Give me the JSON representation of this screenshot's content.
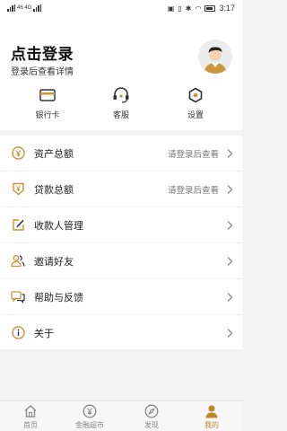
{
  "status_bar": {
    "left_text": "46 4G",
    "time": "3:17"
  },
  "header": {
    "title": "点击登录",
    "subtitle": "登录后查看详情"
  },
  "shortcuts": [
    {
      "label": "银行卡",
      "icon": "bank-card-icon"
    },
    {
      "label": "客服",
      "icon": "headset-icon"
    },
    {
      "label": "设置",
      "icon": "settings-icon"
    }
  ],
  "menu": [
    {
      "label": "资产总额",
      "hint": "请登录后查看",
      "icon": "yen-coin-icon"
    },
    {
      "label": "贷款总额",
      "hint": "请登录后查看",
      "icon": "loan-icon"
    },
    {
      "label": "收款人管理",
      "hint": "",
      "icon": "edit-icon"
    },
    {
      "label": "邀请好友",
      "hint": "",
      "icon": "invite-friends-icon"
    },
    {
      "label": "帮助与反馈",
      "hint": "",
      "icon": "chat-bubbles-icon"
    },
    {
      "label": "关于",
      "hint": "",
      "icon": "info-icon"
    }
  ],
  "tabs": [
    {
      "label": "首页",
      "icon": "home-icon",
      "active": false
    },
    {
      "label": "金融超市",
      "icon": "yen-circle-icon",
      "active": false
    },
    {
      "label": "发现",
      "icon": "compass-icon",
      "active": false
    },
    {
      "label": "我的",
      "icon": "user-icon",
      "active": true
    }
  ],
  "colors": {
    "accent": "#b8892c",
    "icon_dark": "#333333",
    "text_muted": "#777777"
  }
}
